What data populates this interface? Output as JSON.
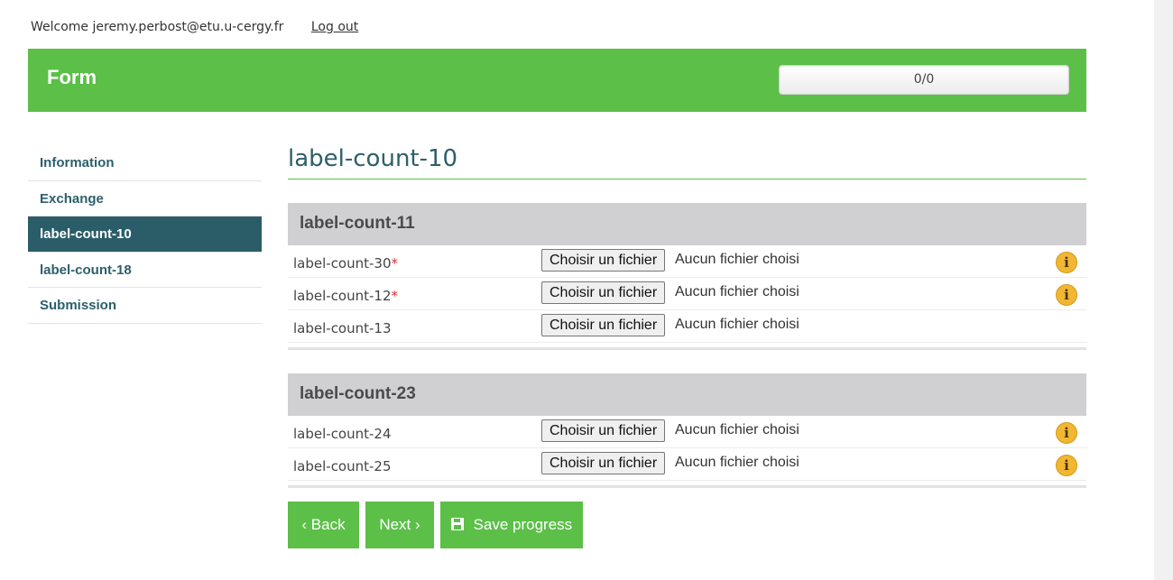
{
  "topbar": {
    "welcome": "Welcome jeremy.perbost@etu.u-cergy.fr",
    "logout": "Log out"
  },
  "header": {
    "title": "Form",
    "progress": "0/0"
  },
  "sidebar": {
    "items": [
      {
        "label": "Information"
      },
      {
        "label": "Exchange"
      },
      {
        "label": "label-count-10",
        "active": true
      },
      {
        "label": "label-count-18"
      },
      {
        "label": "Submission"
      }
    ]
  },
  "main": {
    "title": "label-count-10",
    "sections": [
      {
        "title": "label-count-11",
        "rows": [
          {
            "label": "label-count-30",
            "required": "*",
            "button": "Choisir un fichier",
            "status": "Aucun fichier choisi",
            "info": "i"
          },
          {
            "label": "label-count-12",
            "required": "*",
            "button": "Choisir un fichier",
            "status": "Aucun fichier choisi",
            "info": "i"
          },
          {
            "label": "label-count-13",
            "button": "Choisir un fichier",
            "status": "Aucun fichier choisi"
          }
        ]
      },
      {
        "title": "label-count-23",
        "rows": [
          {
            "label": "label-count-24",
            "button": "Choisir un fichier",
            "status": "Aucun fichier choisi",
            "info": "i"
          },
          {
            "label": "label-count-25",
            "button": "Choisir un fichier",
            "status": "Aucun fichier choisi",
            "info": "i"
          }
        ]
      }
    ]
  },
  "buttons": {
    "back": "Back",
    "next": "Next",
    "save": "Save progress",
    "back_icon": "‹",
    "next_icon": "›"
  },
  "colors": {
    "accent_green": "#5cbf48",
    "nav_active": "#2b5d69",
    "required_red": "#d9312f",
    "info_yellow": "#f2b732"
  },
  "icons": [
    "chevron-left-icon",
    "chevron-right-icon",
    "floppy-disk-icon",
    "info-icon"
  ]
}
